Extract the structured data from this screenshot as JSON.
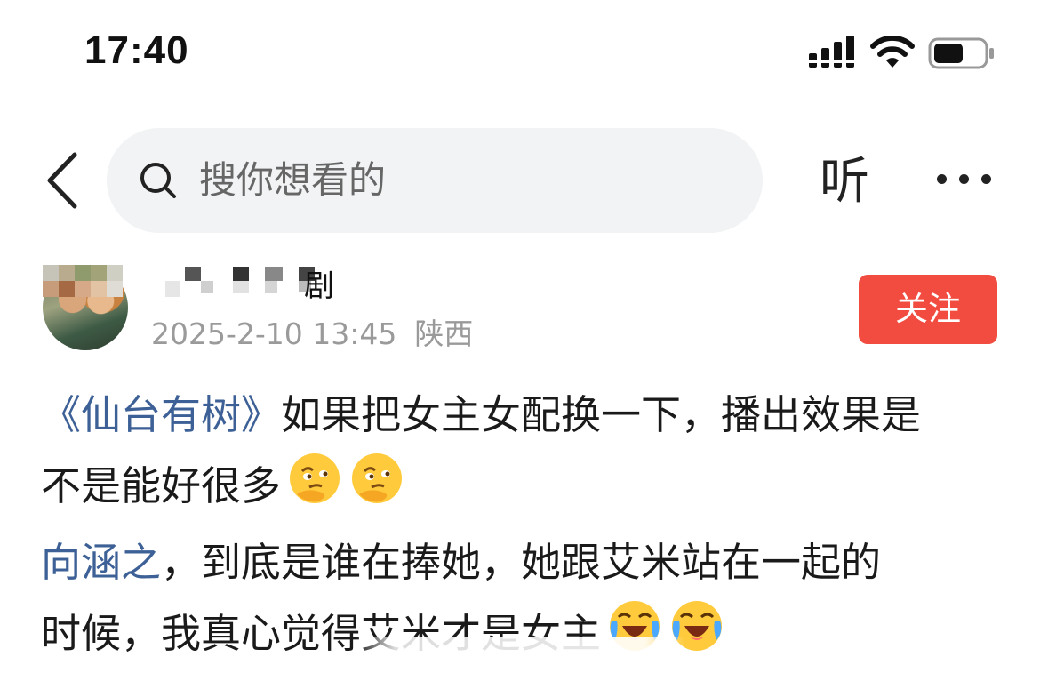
{
  "status_bar": {
    "time": "17:40",
    "icons": [
      "signal-icon",
      "wifi-icon",
      "battery-icon"
    ],
    "battery_level": 0.6
  },
  "nav": {
    "back_icon": "chevron-left-icon",
    "search_placeholder": "搜你想看的",
    "listen_label": "听",
    "more_icon": "ellipsis-icon"
  },
  "author": {
    "name_visible_tail": "剧",
    "date": "2025-2-10 13:45",
    "location": "陕西",
    "follow_label": "关注"
  },
  "post": {
    "p1_title": "《仙台有树》",
    "p1_text": "如果把女主女配换一下，播出效果是",
    "p1_line2": "不是能好很多",
    "p2_link": "向涵之",
    "p2_text": "，到底是谁在捧她，她跟艾米站在一起的",
    "p2_line2": "时候，我真心觉得艾米才是女主"
  },
  "colors": {
    "accent_red": "#f24b3f",
    "link_blue": "#3d6196",
    "meta_gray": "#9a9a9a",
    "search_bg": "#f1f3f4"
  }
}
